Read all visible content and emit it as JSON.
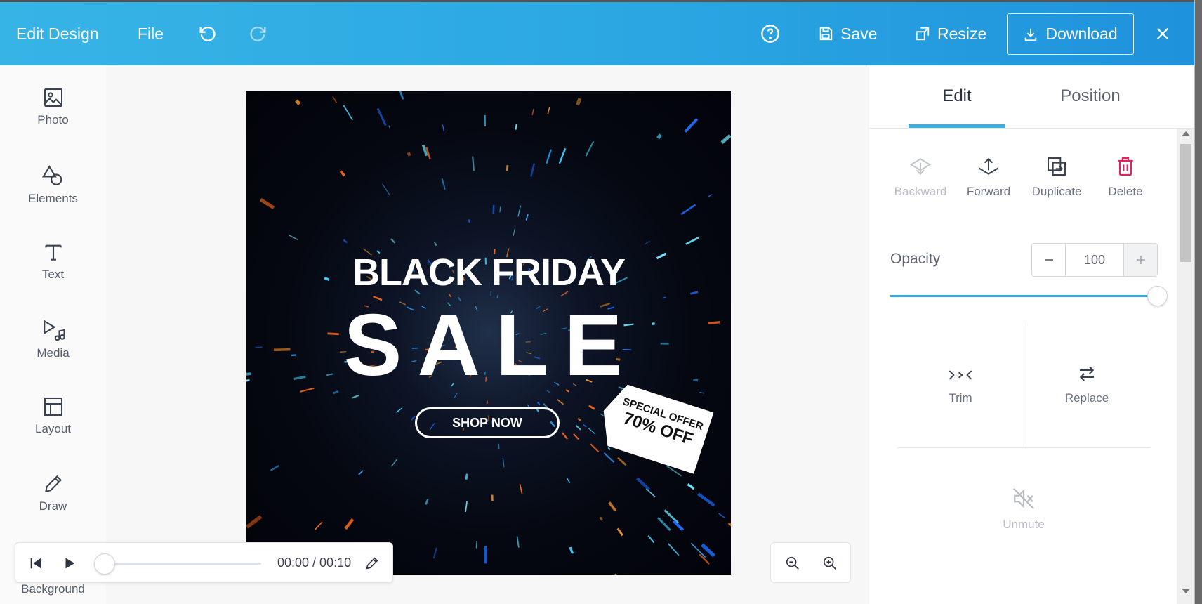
{
  "header": {
    "title": "Edit Design",
    "file_label": "File",
    "save_label": "Save",
    "resize_label": "Resize",
    "download_label": "Download"
  },
  "sidebar": {
    "items": [
      {
        "label": "Photo",
        "icon": "image-icon"
      },
      {
        "label": "Elements",
        "icon": "shapes-icon"
      },
      {
        "label": "Text",
        "icon": "text-icon"
      },
      {
        "label": "Media",
        "icon": "media-icon"
      },
      {
        "label": "Layout",
        "icon": "layout-icon"
      },
      {
        "label": "Draw",
        "icon": "pencil-icon"
      },
      {
        "label": "Background",
        "icon": "background-icon"
      }
    ]
  },
  "design": {
    "headline": "BLACK FRIDAY",
    "subheadline": "SALE",
    "cta": "SHOP NOW",
    "tag_line1": "SPECIAL OFFER",
    "tag_line2": "70% OFF"
  },
  "player": {
    "time": "00:00 / 00:10",
    "progress": 0
  },
  "panel": {
    "tabs": [
      {
        "label": "Edit",
        "active": true
      },
      {
        "label": "Position",
        "active": false
      }
    ],
    "actions": [
      {
        "label": "Backward",
        "disabled": true
      },
      {
        "label": "Forward",
        "disabled": false
      },
      {
        "label": "Duplicate",
        "disabled": false
      },
      {
        "label": "Delete",
        "disabled": false
      }
    ],
    "opacity_label": "Opacity",
    "opacity_value": "100",
    "opacity_level": 1.0,
    "trim_label": "Trim",
    "replace_label": "Replace",
    "unmute_label": "Unmute"
  },
  "colors": {
    "accent": "#2ea8e4",
    "delete": "#e0245e",
    "tab_underline": "#3bb0e3"
  }
}
